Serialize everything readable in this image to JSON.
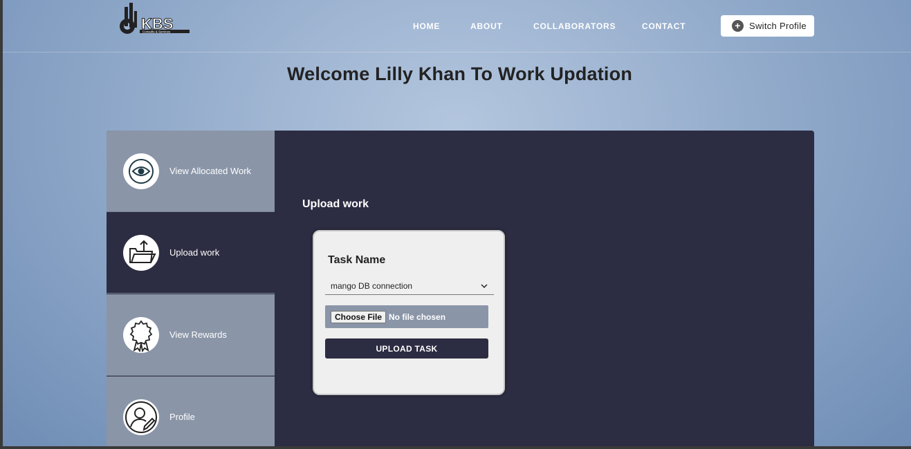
{
  "header": {
    "logo_text": "KBS",
    "logo_tagline": "Consults & Services",
    "nav": [
      "HOME",
      "ABOUT",
      "COLLABORATORS",
      "CONTACT"
    ],
    "switch_profile": "Switch Profile"
  },
  "welcome": "Welcome Lilly Khan To Work Updation",
  "sidebar": {
    "items": [
      {
        "label": "View Allocated Work",
        "icon": "eye-icon",
        "active": false
      },
      {
        "label": "Upload work",
        "icon": "folder-upload-icon",
        "active": true
      },
      {
        "label": "View Rewards",
        "icon": "award-ribbon-icon",
        "active": false
      },
      {
        "label": "Profile",
        "icon": "user-edit-icon",
        "active": false
      }
    ]
  },
  "main": {
    "section_title": "Upload work",
    "form": {
      "task_label": "Task Name",
      "task_selected": "mango DB connection",
      "choose_file": "Choose File",
      "no_file": "No file chosen",
      "submit": "UPLOAD TASK"
    }
  },
  "colors": {
    "panel_bg": "#2c2c42",
    "sidebar_bg": "#8a95a8",
    "card_bg": "#efefef"
  }
}
